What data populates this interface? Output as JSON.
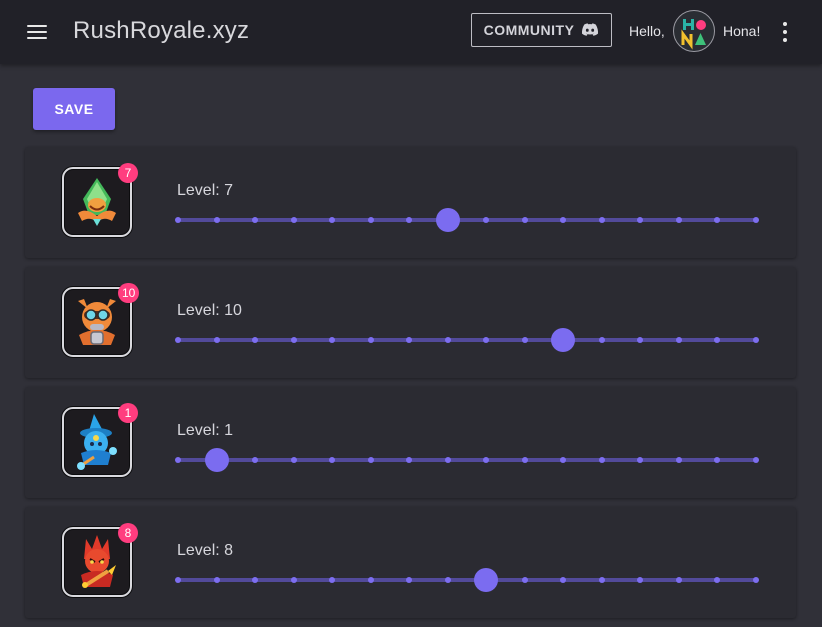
{
  "app": {
    "title": "RushRoyale.xyz",
    "community_label": "COMMUNITY",
    "greeting": "Hello,",
    "user_name": "Hona!",
    "accent_color": "#7b68ee",
    "badge_color": "#ff3d7f"
  },
  "toolbar": {
    "save_label": "SAVE"
  },
  "slider_config": {
    "min": 0,
    "max": 15
  },
  "units": [
    {
      "level": 7,
      "badge": "7",
      "level_text": "Level: 7",
      "icon": "green-hooded-unit-icon"
    },
    {
      "level": 10,
      "badge": "10",
      "level_text": "Level: 10",
      "icon": "orange-engineer-unit-icon"
    },
    {
      "level": 1,
      "badge": "1",
      "level_text": "Level: 1",
      "icon": "blue-wizard-unit-icon"
    },
    {
      "level": 8,
      "badge": "8",
      "level_text": "Level: 8",
      "icon": "red-fire-mage-unit-icon"
    }
  ]
}
